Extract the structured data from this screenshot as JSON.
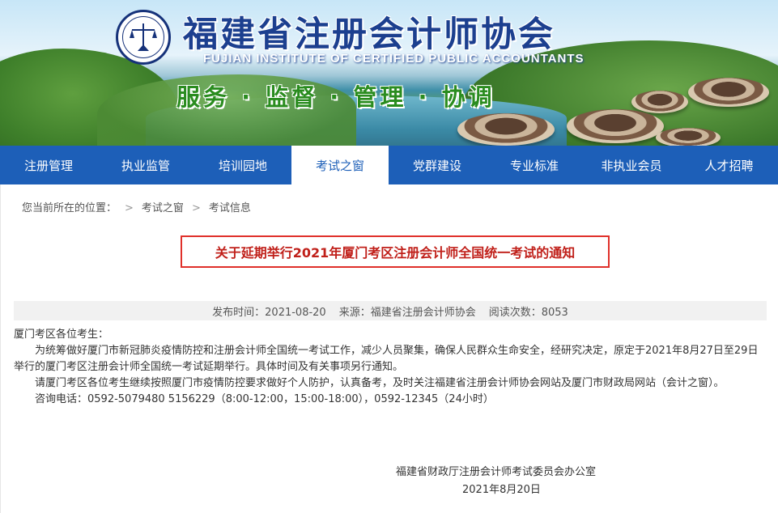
{
  "banner": {
    "title_cn": "福建省注册会计师协会",
    "title_en": "FUJIAN INSTITUTE OF CERTIFIED PUBLIC ACCOUNTANTS",
    "slogan": "服务 · 监督 · 管理 · 协调",
    "logo_icon": "cicpa-seal-icon"
  },
  "nav": {
    "items": [
      {
        "label": "注册管理"
      },
      {
        "label": "执业监管"
      },
      {
        "label": "培训园地"
      },
      {
        "label": "考试之窗"
      },
      {
        "label": "党群建设"
      },
      {
        "label": "专业标准"
      },
      {
        "label": "非执业会员"
      },
      {
        "label": "人才招聘"
      }
    ],
    "active_index": 3,
    "bg_color": "#1d5fb8"
  },
  "breadcrumb": {
    "prefix": "您当前所在的位置：",
    "items": [
      "考试之窗",
      "考试信息"
    ],
    "separator": ">"
  },
  "article": {
    "title": "关于延期举行2021年厦门考区注册会计师全国统一考试的通知",
    "meta": {
      "publish_time": "发布时间：2021-08-20",
      "source": "来源：福建省注册会计师协会",
      "views": "阅读次数：8053"
    },
    "greeting": "厦门考区各位考生：",
    "paragraphs": [
      "为统筹做好厦门市新冠肺炎疫情防控和注册会计师全国统一考试工作，减少人员聚集，确保人民群众生命安全，经研究决定，原定于2021年8月27日至29日举行的厦门考区注册会计师全国统一考试延期举行。具体时间及有关事项另行通知。",
      "请厦门考区各位考生继续按照厦门市疫情防控要求做好个人防护，认真备考，及时关注福建省注册会计师协会网站及厦门市财政局网站（会计之窗）。",
      "咨询电话：0592-5079480  5156229（8:00-12:00，15:00-18:00），0592-12345（24小时）"
    ],
    "signature_org": "福建省财政厅注册会计师考试委员会办公室",
    "signature_date": "2021年8月20日",
    "highlight_color": "#e0302a"
  }
}
